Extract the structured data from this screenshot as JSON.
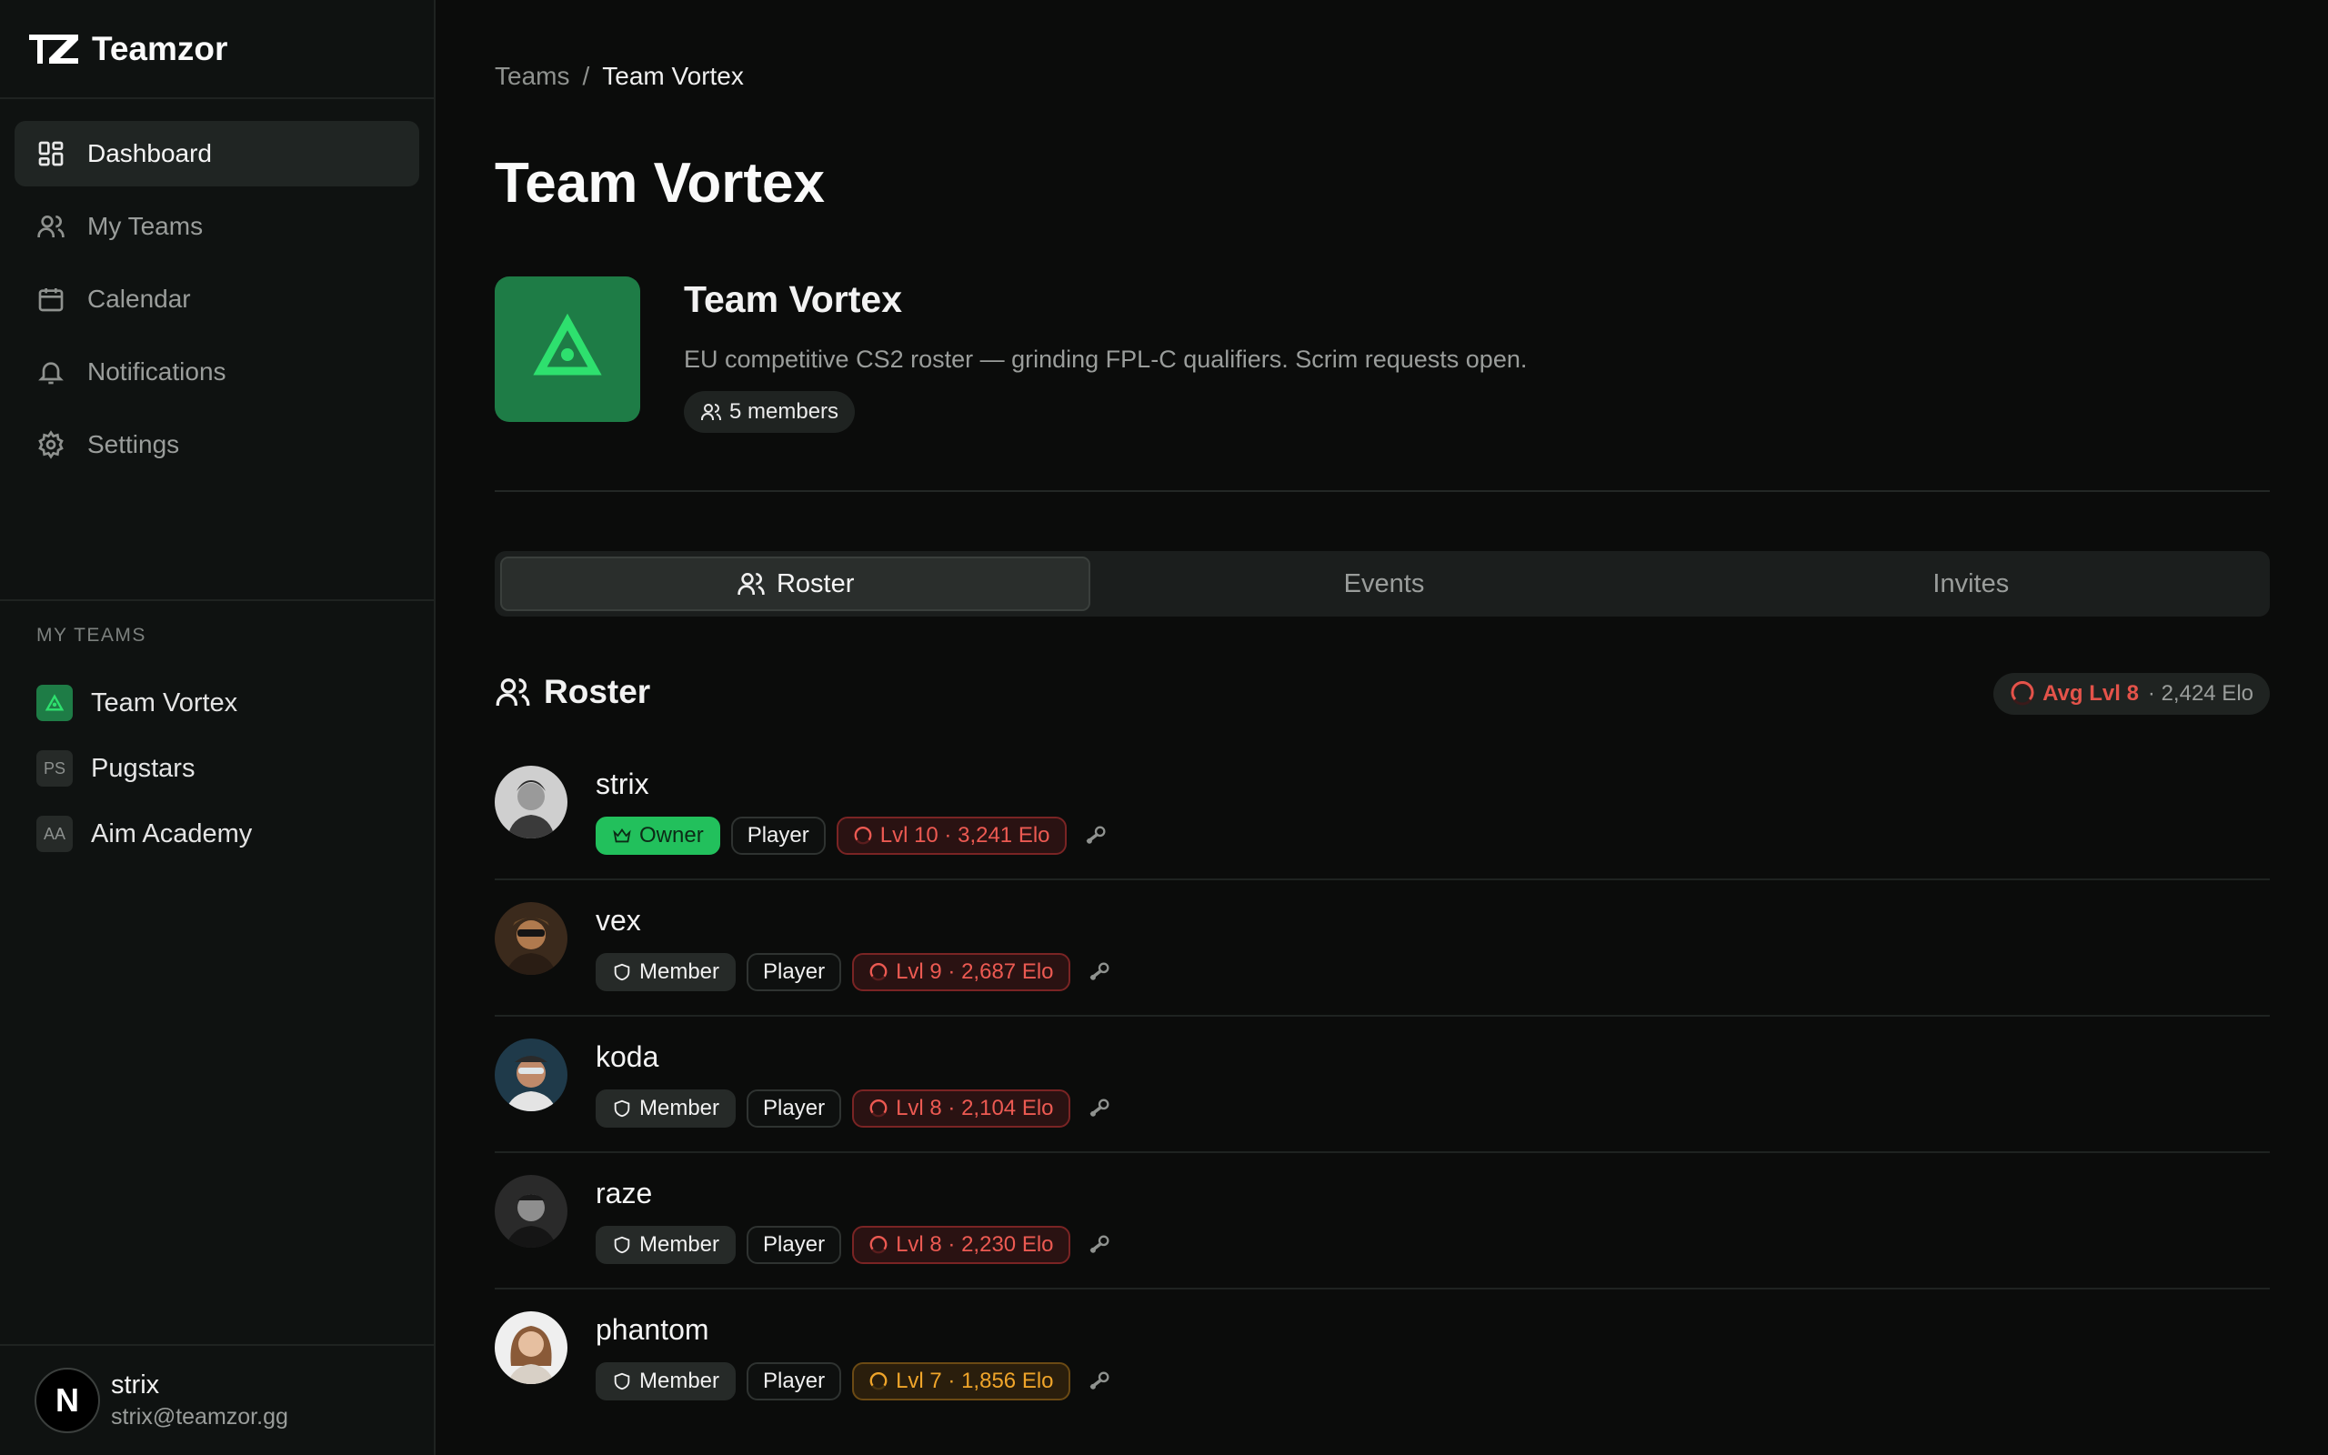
{
  "app": {
    "name": "Teamzor"
  },
  "nav": [
    {
      "label": "Dashboard",
      "icon": "dashboard-icon",
      "active": true
    },
    {
      "label": "My Teams",
      "icon": "users-icon"
    },
    {
      "label": "Calendar",
      "icon": "calendar-icon"
    },
    {
      "label": "Notifications",
      "icon": "bell-icon"
    },
    {
      "label": "Settings",
      "icon": "gear-icon"
    }
  ],
  "sidebar_teams": {
    "label": "MY TEAMS",
    "items": [
      {
        "name": "Team Vortex",
        "badge": ""
      },
      {
        "name": "Pugstars",
        "badge": "PS"
      },
      {
        "name": "Aim Academy",
        "badge": "AA"
      }
    ]
  },
  "user": {
    "name": "strix",
    "email": "strix@teamzor.gg",
    "avatar_letter": "N"
  },
  "breadcrumb": {
    "root": "Teams",
    "separator": "/",
    "current": "Team Vortex"
  },
  "page_title": "Team Vortex",
  "team": {
    "name": "Team Vortex",
    "description": "EU competitive CS2 roster — grinding FPL-C qualifiers. Scrim requests open.",
    "members": "5 members",
    "color": "#1e7c46"
  },
  "tabs": [
    {
      "label": "Roster",
      "active": true
    },
    {
      "label": "Events"
    },
    {
      "label": "Invites"
    }
  ],
  "roster": {
    "title": "Roster",
    "avg_level": "Avg Lvl 8",
    "avg_elo": "· 2,424 Elo",
    "players": [
      {
        "name": "strix",
        "role_badge": "Owner",
        "role": "Player",
        "elo": "Lvl 10 · 3,241 Elo",
        "level": 10
      },
      {
        "name": "vex",
        "role_badge": "Member",
        "role": "Player",
        "elo": "Lvl 9 · 2,687 Elo",
        "level": 9
      },
      {
        "name": "koda",
        "role_badge": "Member",
        "role": "Player",
        "elo": "Lvl 8 · 2,104 Elo",
        "level": 8
      },
      {
        "name": "raze",
        "role_badge": "Member",
        "role": "Player",
        "elo": "Lvl 8 · 2,230 Elo",
        "level": 8
      },
      {
        "name": "phantom",
        "role_badge": "Member",
        "role": "Player",
        "elo": "Lvl 7 · 1,856 Elo",
        "level": 7
      }
    ]
  },
  "colors": {
    "accent": "#22c05c",
    "elo_red": "#ec5a52",
    "elo_gold": "#f0a52a"
  }
}
